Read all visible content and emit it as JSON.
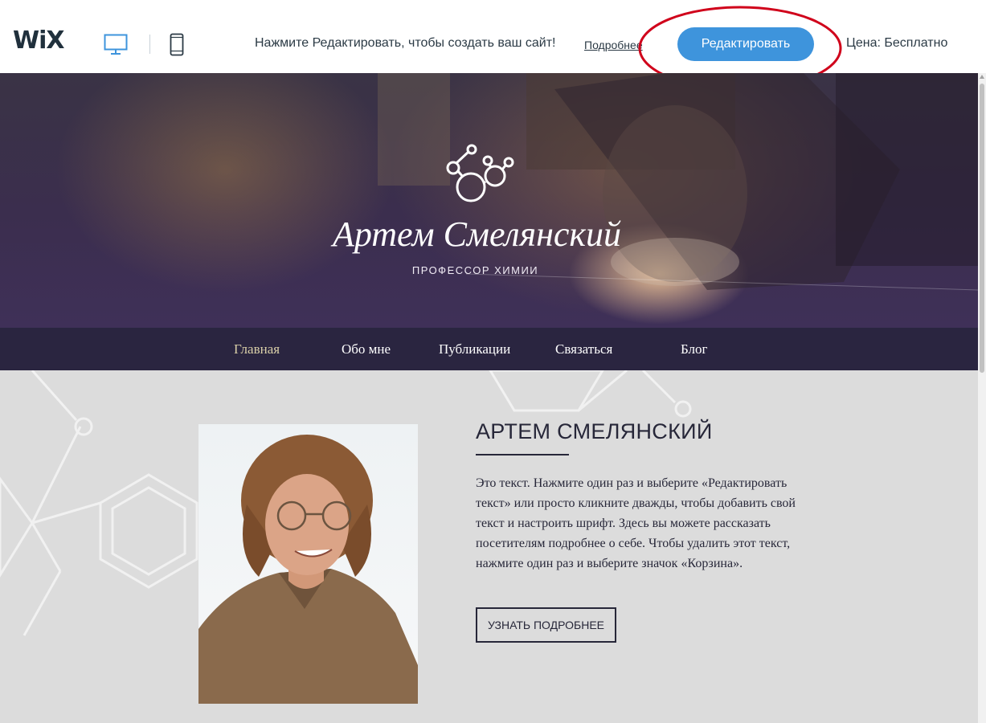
{
  "topbar": {
    "logo": "WiX",
    "promo_text": "Нажмите Редактировать, чтобы создать ваш сайт!",
    "more_link": "Подробнее",
    "edit_button": "Редактировать",
    "price": "Цена: Бесплатно",
    "device_icons": [
      "desktop-icon",
      "mobile-icon"
    ],
    "accent_color": "#3e94dc",
    "highlight_color": "#d0021b"
  },
  "hero": {
    "name": "Артем Смелянский",
    "subtitle": "ПРОФЕССОР ХИМИИ",
    "icon": "molecule-icon"
  },
  "nav": {
    "items": [
      {
        "label": "Главная",
        "active": true
      },
      {
        "label": "Обо мне",
        "active": false
      },
      {
        "label": "Публикации",
        "active": false
      },
      {
        "label": "Связаться",
        "active": false
      },
      {
        "label": "Блог",
        "active": false
      }
    ]
  },
  "about": {
    "title": "АРТЕМ СМЕЛЯНСКИЙ",
    "text": "Это текст. Нажмите один раз и выберите «Редактировать текст» или просто кликните дважды, чтобы добавить свой текст и настроить шрифт. Здесь вы можете рассказать посетителям подробнее о себе. Чтобы удалить этот текст, нажмите один раз и выберите значок «Корзина».",
    "button": "УЗНАТЬ ПОДРОБНЕЕ"
  }
}
